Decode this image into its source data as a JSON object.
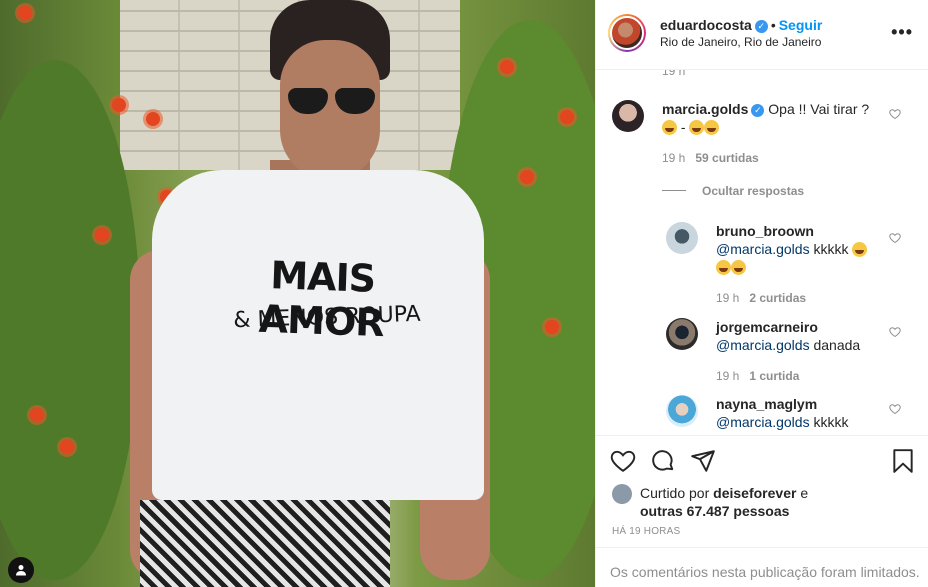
{
  "photo": {
    "shirt_line1": "MAIS AMOR",
    "shirt_line2": "& MENOS ROUPA"
  },
  "post_header": {
    "username": "eduardocosta",
    "separator": "•",
    "follow_label": "Seguir",
    "location": "Rio de Janeiro, Rio de Janeiro",
    "more_icon": "more-horizontal-icon"
  },
  "comments": {
    "top_partial_time": "19 h",
    "main": {
      "username": "marcia.golds",
      "text": "Opa !! Vai tirar ?",
      "text_tail": "-",
      "time": "19 h",
      "likes": "59 curtidas"
    },
    "hide_replies": "Ocultar respostas",
    "replies": [
      {
        "username": "bruno_broown",
        "mention": "@marcia.golds",
        "text": "kkkkk",
        "time": "19 h",
        "likes": "2 curtidas"
      },
      {
        "username": "jorgemcarneiro",
        "mention": "@marcia.golds",
        "text": "danada",
        "time": "19 h",
        "likes": "1 curtida"
      },
      {
        "username": "nayna_maglym",
        "mention": "@marcia.golds",
        "text": "kkkkk"
      }
    ]
  },
  "actions": {
    "liked_prefix": "Curtido por",
    "liked_user": "deiseforever",
    "liked_and": "e",
    "liked_others": "outras 67.487 pessoas",
    "posted_ago": "HÁ 19 HORAS"
  },
  "footer": {
    "limited_text": "Os comentários nesta publicação foram limitados."
  }
}
